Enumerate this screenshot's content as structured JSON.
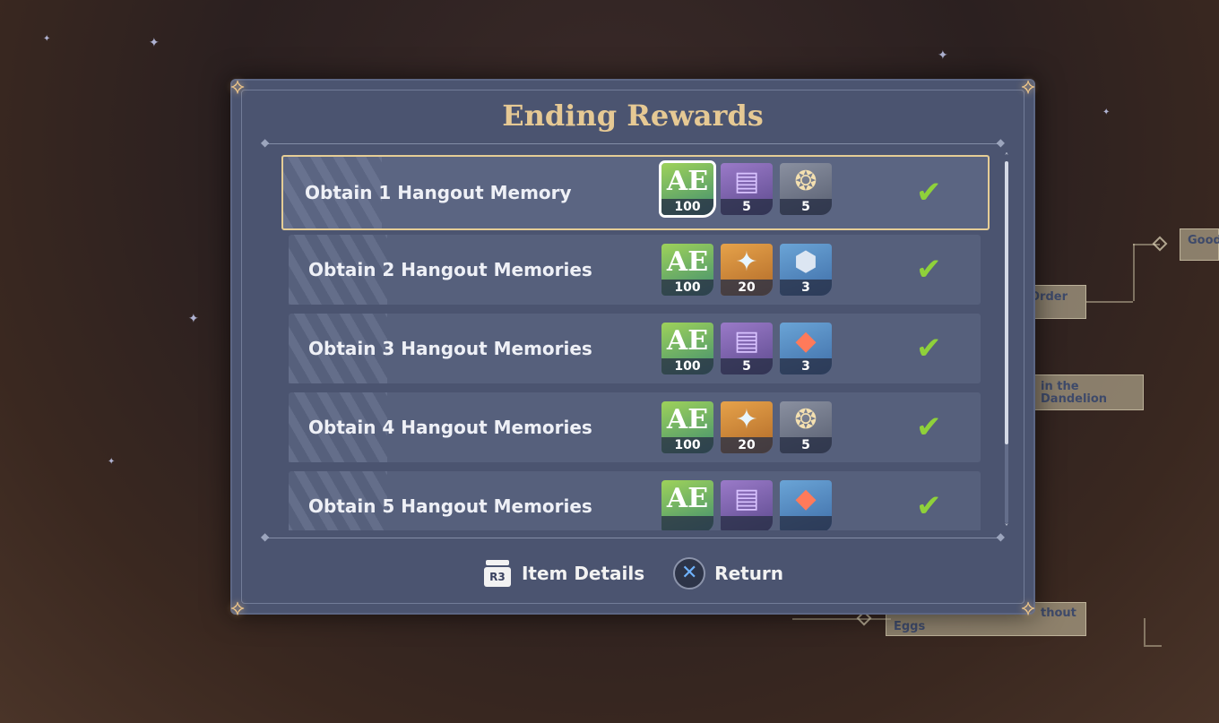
{
  "background": {
    "nodes": [
      {
        "text": "Good"
      },
      {
        "text": "Order"
      },
      {
        "text": "in the Dandelion"
      },
      {
        "text": "Eggs"
      },
      {
        "text": "thout"
      }
    ]
  },
  "modal": {
    "title": "Ending Rewards",
    "rows": [
      {
        "label": "Obtain 1 Hangout Memory",
        "completed": true,
        "rewards": [
          {
            "icon": "hero-wit-exp-icon",
            "count": "100"
          },
          {
            "icon": "purple-book-icon",
            "count": "5"
          },
          {
            "icon": "wings-glider-icon",
            "count": "5"
          }
        ]
      },
      {
        "label": "Obtain 2 Hangout Memories",
        "completed": true,
        "rewards": [
          {
            "icon": "hero-wit-exp-icon",
            "count": "100"
          },
          {
            "icon": "primogem-icon",
            "count": "20"
          },
          {
            "icon": "mystic-enhancement-ore-icon",
            "count": "3"
          }
        ]
      },
      {
        "label": "Obtain 3 Hangout Memories",
        "completed": true,
        "rewards": [
          {
            "icon": "hero-wit-exp-icon",
            "count": "100"
          },
          {
            "icon": "purple-book-icon",
            "count": "5"
          },
          {
            "icon": "red-crystal-shard-icon",
            "count": "3"
          }
        ]
      },
      {
        "label": "Obtain 4 Hangout Memories",
        "completed": true,
        "rewards": [
          {
            "icon": "hero-wit-exp-icon",
            "count": "100"
          },
          {
            "icon": "primogem-icon",
            "count": "20"
          },
          {
            "icon": "wings-glider-icon",
            "count": "5"
          }
        ]
      },
      {
        "label": "Obtain 5 Hangout Memories",
        "completed": true,
        "rewards": [
          {
            "icon": "hero-wit-exp-icon",
            "count": ""
          },
          {
            "icon": "purple-book-icon",
            "count": ""
          },
          {
            "icon": "red-crystal-shard-icon",
            "count": ""
          }
        ]
      }
    ],
    "footer": {
      "item_details_label": "Item Details",
      "item_details_key": "R3",
      "return_label": "Return"
    }
  },
  "colors": {
    "title": "#e6c994",
    "panel": "#4b5470",
    "selected_border": "#e5cd96",
    "check": "#8fd13a"
  }
}
